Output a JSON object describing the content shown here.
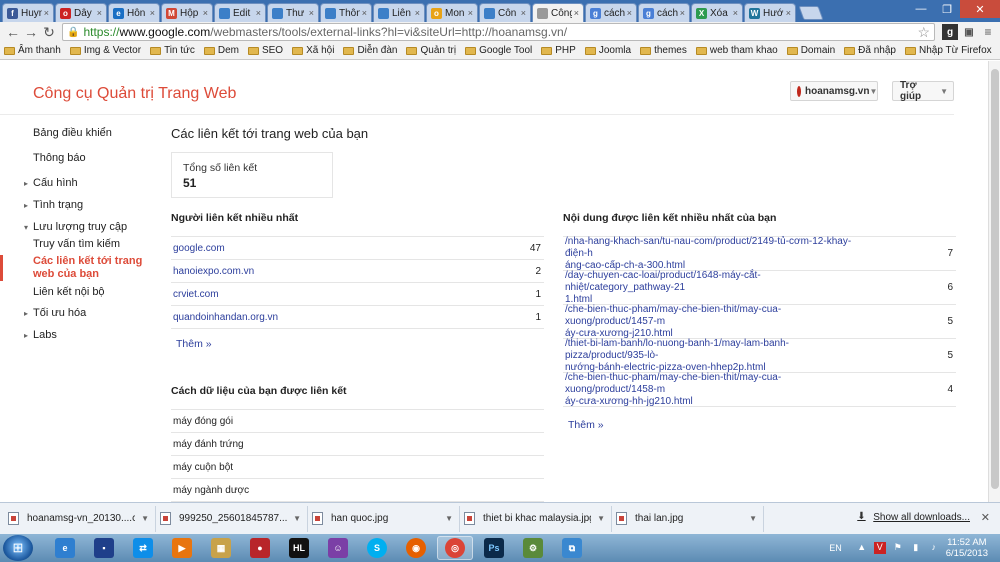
{
  "browser": {
    "tabs": [
      {
        "label": "Huyn",
        "fav": "facebook-icon",
        "color": "#3b5998",
        "glyph": "f"
      },
      {
        "label": "Dây",
        "fav": "opera-icon",
        "color": "#cc2222",
        "glyph": "o"
      },
      {
        "label": "Hỗn",
        "fav": "site-icon",
        "color": "#1a6fc4",
        "glyph": "e"
      },
      {
        "label": "Hộp",
        "fav": "gmail-icon",
        "color": "#d14836",
        "glyph": "M"
      },
      {
        "label": "Edit",
        "fav": "page-icon",
        "color": "#3c7fc8",
        "glyph": ""
      },
      {
        "label": "Thư",
        "fav": "page-icon",
        "color": "#3c7fc8",
        "glyph": ""
      },
      {
        "label": "Thôn",
        "fav": "page-icon",
        "color": "#3c7fc8",
        "glyph": ""
      },
      {
        "label": "Liên",
        "fav": "page-icon",
        "color": "#3c7fc8",
        "glyph": ""
      },
      {
        "label": "Mon",
        "fav": "site-icon",
        "color": "#e8a317",
        "glyph": "o"
      },
      {
        "label": "Côn",
        "fav": "page-icon",
        "color": "#3c7fc8",
        "glyph": ""
      },
      {
        "label": "Công",
        "fav": "webmaster-icon",
        "color": "#999999",
        "glyph": ""
      },
      {
        "label": "cách",
        "fav": "google-icon",
        "color": "#4a7fd6",
        "glyph": "g"
      },
      {
        "label": "cách",
        "fav": "google-icon",
        "color": "#4a7fd6",
        "glyph": "g"
      },
      {
        "label": "Xóa",
        "fav": "site-icon",
        "color": "#2e9b4f",
        "glyph": "X"
      },
      {
        "label": "Hướ",
        "fav": "wordpress-icon",
        "color": "#21759b",
        "glyph": "W"
      }
    ],
    "url_scheme": "https://",
    "url_host": "www.google.com",
    "url_path": "/webmasters/tools/external-links?hl=vi&siteUrl=http://hoanamsg.vn/",
    "bookmarks": [
      "Âm thanh",
      "Img & Vector",
      "Tin tức",
      "Dem",
      "SEO",
      "Xã hội",
      "Diễn đàn",
      "Quản trị",
      "Google Tool",
      "PHP",
      "Joomla",
      "themes",
      "web tham khao",
      "Domain",
      "Đã nhập",
      "Nhập Từ Firefox"
    ]
  },
  "header": {
    "title": "Công cụ Quản trị Trang Web",
    "site": "hoanamsg.vn",
    "help": "Trợ giúp"
  },
  "sidebar": {
    "items": [
      {
        "label": "Bảng điều khiển"
      },
      {
        "label": "Thông báo"
      },
      {
        "label": "Cấu hình"
      },
      {
        "label": "Tình trạng"
      },
      {
        "label": "Lưu lượng truy cập"
      },
      {
        "label": "Truy vấn tìm kiếm"
      },
      {
        "label": "Các liên kết tới trang web của bạn"
      },
      {
        "label": "Liên kết nội bộ"
      },
      {
        "label": "Tối ưu hóa"
      },
      {
        "label": "Labs"
      }
    ]
  },
  "main": {
    "title": "Các liên kết tới trang web của bạn",
    "total_label": "Tổng số liên kết",
    "total_value": "51",
    "linkers_heading": "Người liên kết nhiều nhất",
    "linkers": [
      {
        "domain": "google.com",
        "count": "47"
      },
      {
        "domain": "hanoiexpo.com.vn",
        "count": "2"
      },
      {
        "domain": "crviet.com",
        "count": "1"
      },
      {
        "domain": "quandoinhandan.org.vn",
        "count": "1"
      }
    ],
    "more1": "Thêm »",
    "anchors_heading": "Cách dữ liệu của bạn được liên kết",
    "anchors": [
      "máy đóng gói",
      "máy đánh trứng",
      "máy cuộn bột",
      "máy ngành dược"
    ],
    "content_heading": "Nội dung được liên kết nhiều nhất của bạn",
    "content": [
      {
        "line1": "/nha-hang-khach-san/tu-nau-com/product/2149-tủ-cơm-12-khay-điện-h",
        "line2": "áng-cao-cấp-ch-a-300.html",
        "count": "7"
      },
      {
        "line1": "/day-chuyen-cac-loai/product/1648-máy-cắt-nhiệt/category_pathway-21",
        "line2": "1.html",
        "count": "6"
      },
      {
        "line1": "/che-bien-thuc-pham/may-che-bien-thit/may-cua-xuong/product/1457-m",
        "line2": "áy-cưa-xương-j210.html",
        "count": "5"
      },
      {
        "line1": "/thiet-bi-lam-banh/lo-nuong-banh-1/may-lam-banh-pizza/product/935-lò-",
        "line2": "nướng-bánh-electric-pizza-oven-hhep2p.html",
        "count": "5"
      },
      {
        "line1": "/che-bien-thuc-pham/may-che-bien-thit/may-cua-xuong/product/1458-m",
        "line2": "áy-cưa-xương-hh-jg210.html",
        "count": "4"
      }
    ],
    "more2": "Thêm »"
  },
  "downloads": {
    "items": [
      "hoanamsg-vn_20130....csv",
      "999250_25601845787....jpg",
      "han quoc.jpg",
      "thiet bi khac malaysia.jpg",
      "thai lan.jpg"
    ],
    "show_all": "Show all downloads..."
  },
  "taskbar": {
    "lang": "EN",
    "time": "11:52 AM",
    "date": "6/15/2013"
  }
}
